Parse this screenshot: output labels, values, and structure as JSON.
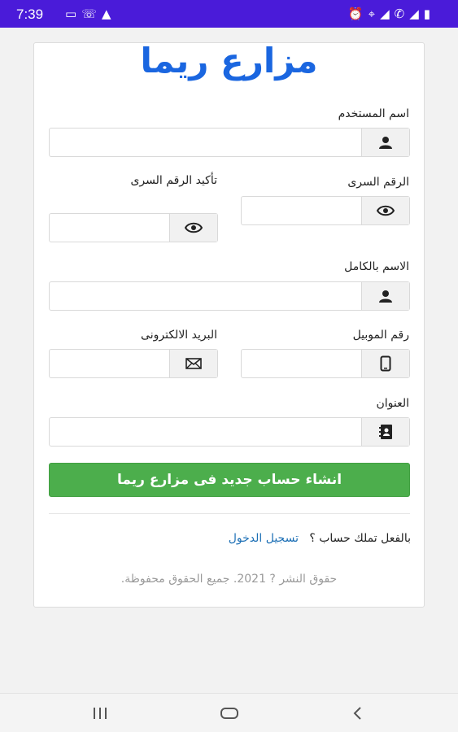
{
  "status_bar": {
    "time": "7:39",
    "left_icons": [
      "laptop-icon",
      "whatsapp-icon",
      "notification-icon"
    ],
    "right_icons": [
      "alarm-icon",
      "wifi-icon",
      "signal-icon",
      "call-icon",
      "signal-icon",
      "battery-icon"
    ]
  },
  "app": {
    "title": "مزارع ريما"
  },
  "form": {
    "username_label": "اسم المستخدم",
    "password_label": "الرقم السرى",
    "confirm_password_label": "تأكيد الرقم السرى",
    "fullname_label": "الاسم بالكامل",
    "mobile_label": "رقم الموبيل",
    "email_label": "البريد الالكترونى",
    "address_label": "العنوان",
    "username_value": "",
    "password_value": "",
    "confirm_password_value": "",
    "fullname_value": "",
    "mobile_value": "",
    "email_value": "",
    "address_value": "",
    "icons": {
      "username": "user-icon",
      "password": "eye-icon",
      "confirm_password": "eye-icon",
      "fullname": "user-icon",
      "mobile": "mobile-icon",
      "email": "envelope-icon",
      "address": "address-book-icon"
    },
    "submit_label": "انشاء حساب جديد فى مزارع ريما"
  },
  "login": {
    "prompt": "بالفعل تملك حساب ؟",
    "link_label": "تسجيل الدخول"
  },
  "footer": {
    "copyright": "حقوق النشر ? 2021. جميع الحقوق محفوظة."
  },
  "colors": {
    "status_bar": "#4a1bd9",
    "title": "#1a66e0",
    "submit": "#4cae4c",
    "link": "#1c6fb5"
  }
}
